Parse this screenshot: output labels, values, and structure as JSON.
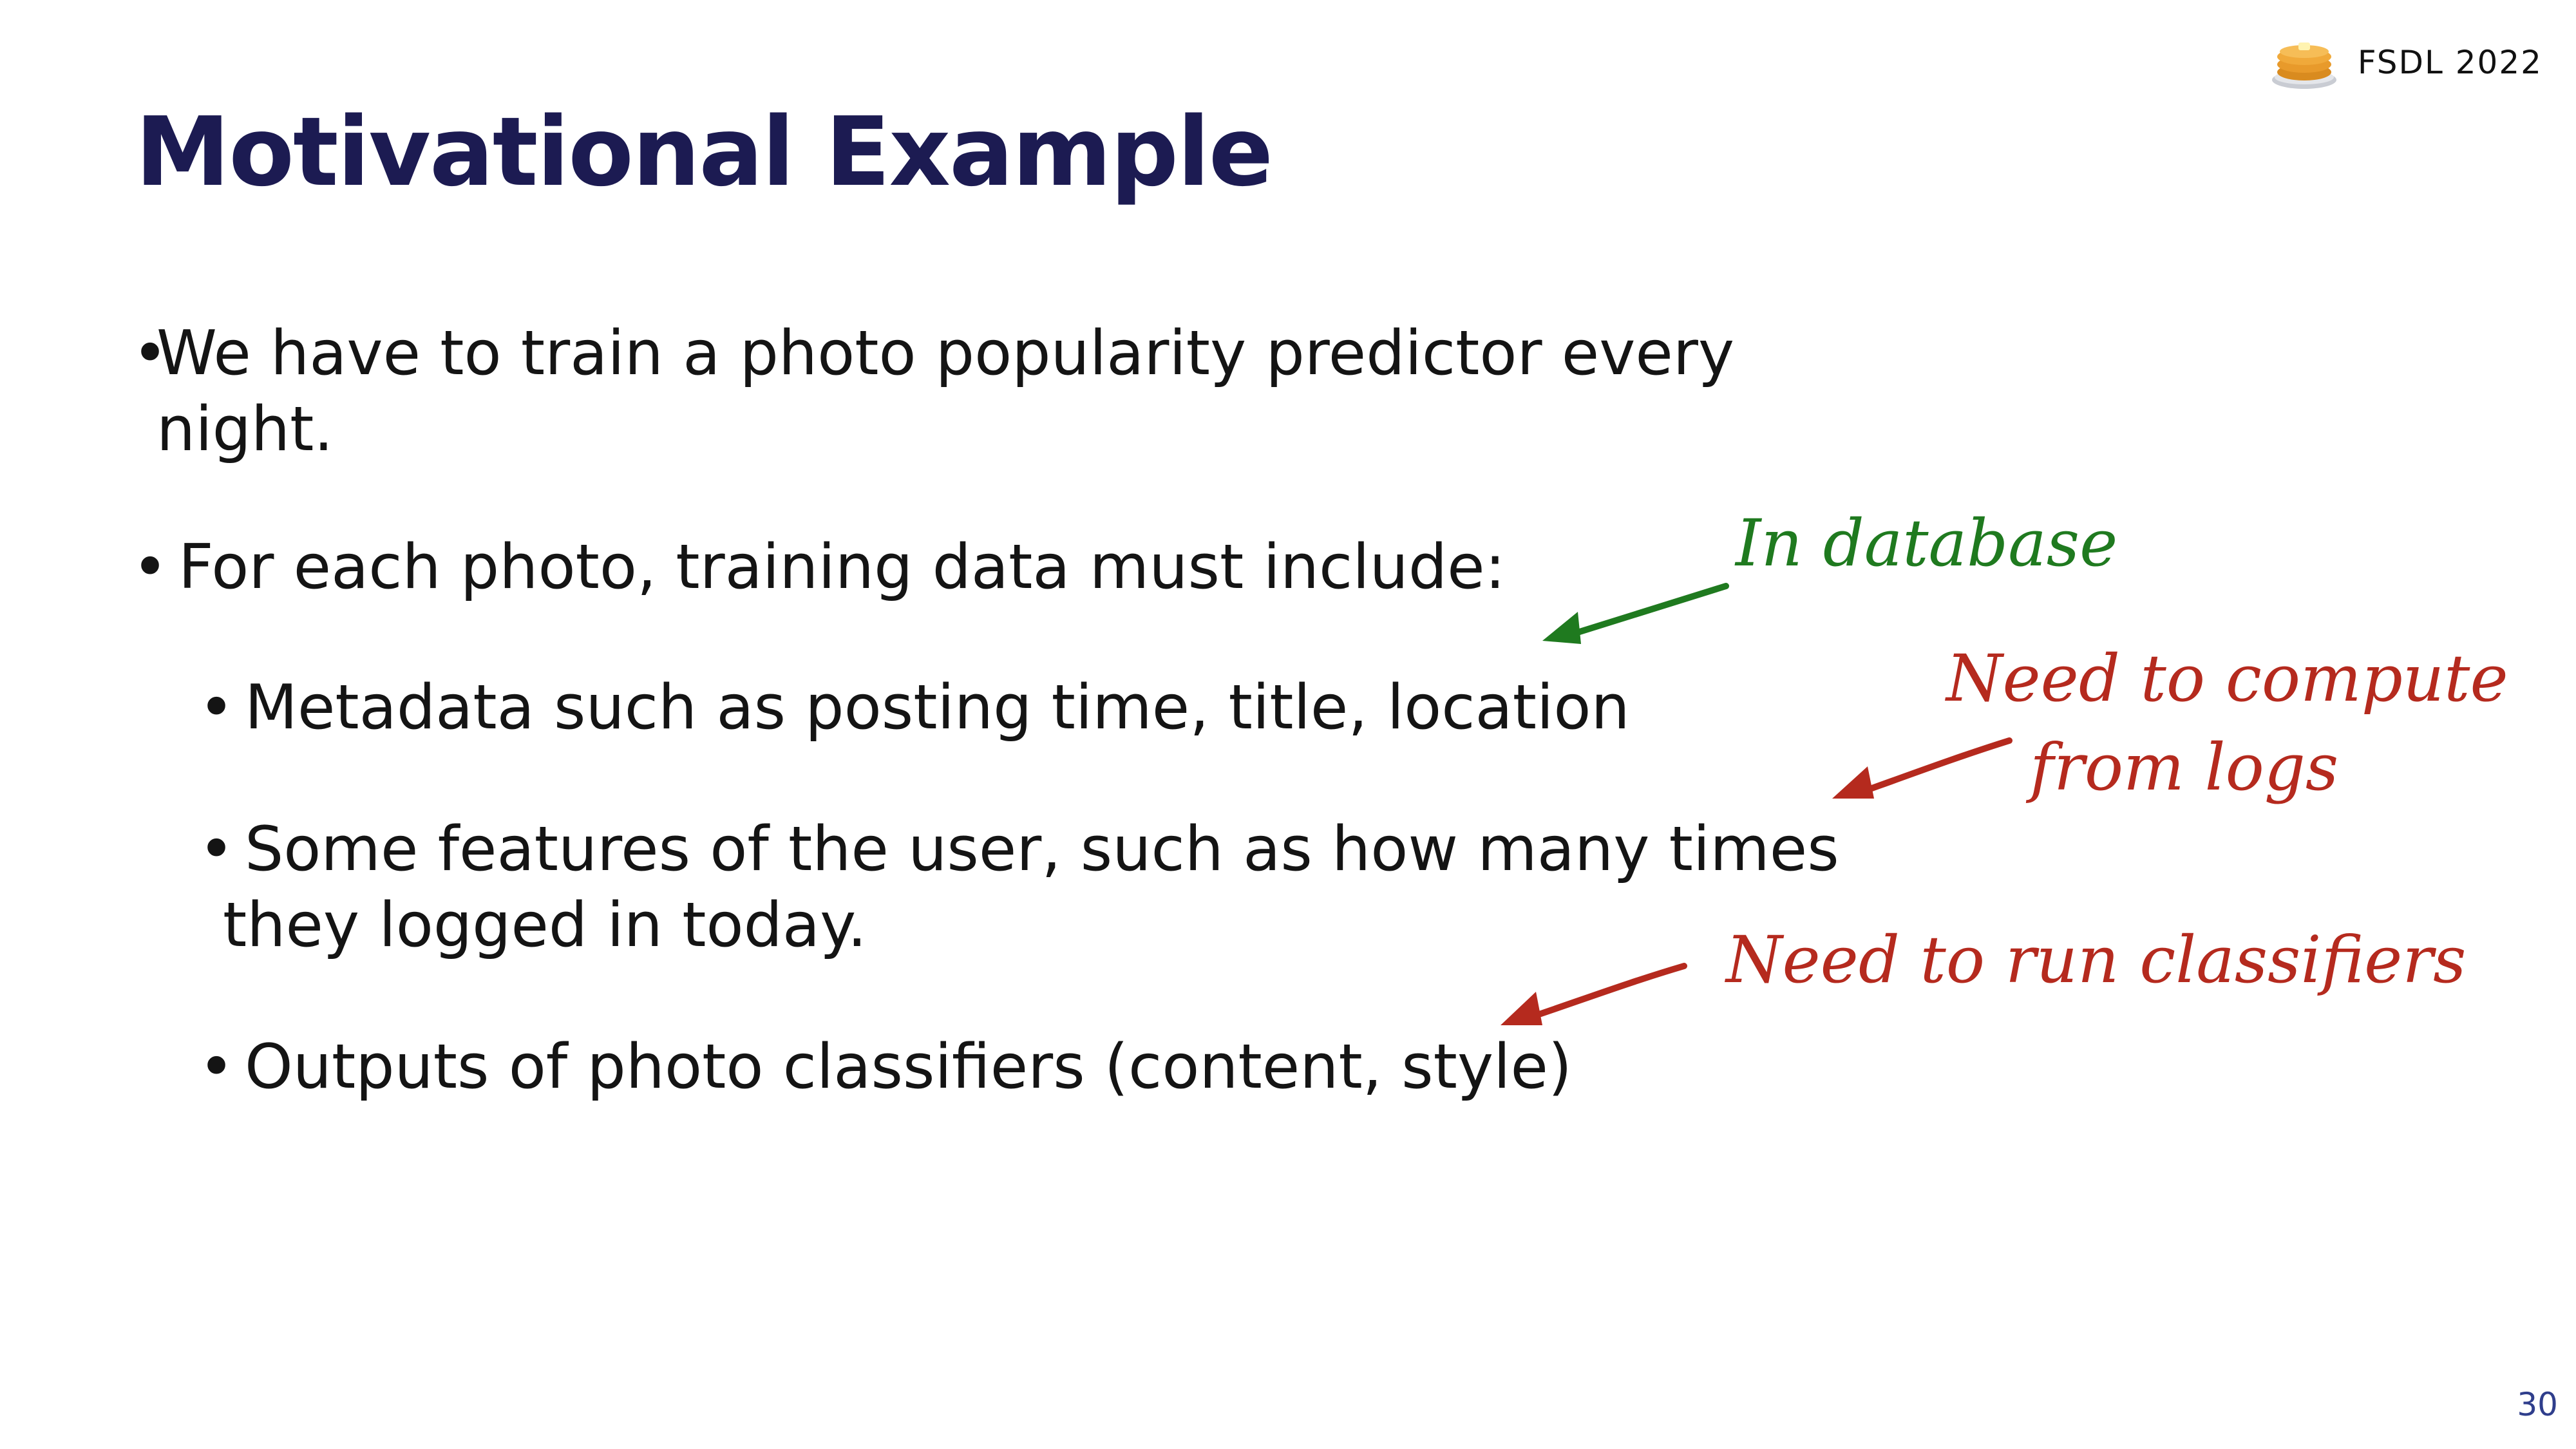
{
  "slide": {
    "title": "Motivational Example",
    "brand_label": "FSDL 2022",
    "brand_icon": "pancake-stack-icon",
    "page_number": "30"
  },
  "bullets": {
    "b1_line1": "We have to train a photo popularity predictor every",
    "b1_line2": "night.",
    "b2": "For each photo, training data must include:",
    "sub1": "Metadata such as posting time, title, location",
    "sub2_line1": "Some features of the user, such as how many times",
    "sub2_line2": "they logged in today.",
    "sub3": "Outputs of photo classifiers (content, style)"
  },
  "annotations": {
    "in_database": "In database",
    "need_compute_line1": "Need to compute",
    "need_compute_line2": "from logs",
    "need_classifiers": "Need to run classifiers"
  },
  "colors": {
    "title": "#1c1b52",
    "green_annotation": "#1f7a1f",
    "red_annotation": "#b52a1e",
    "page_number": "#2f3e8c"
  }
}
